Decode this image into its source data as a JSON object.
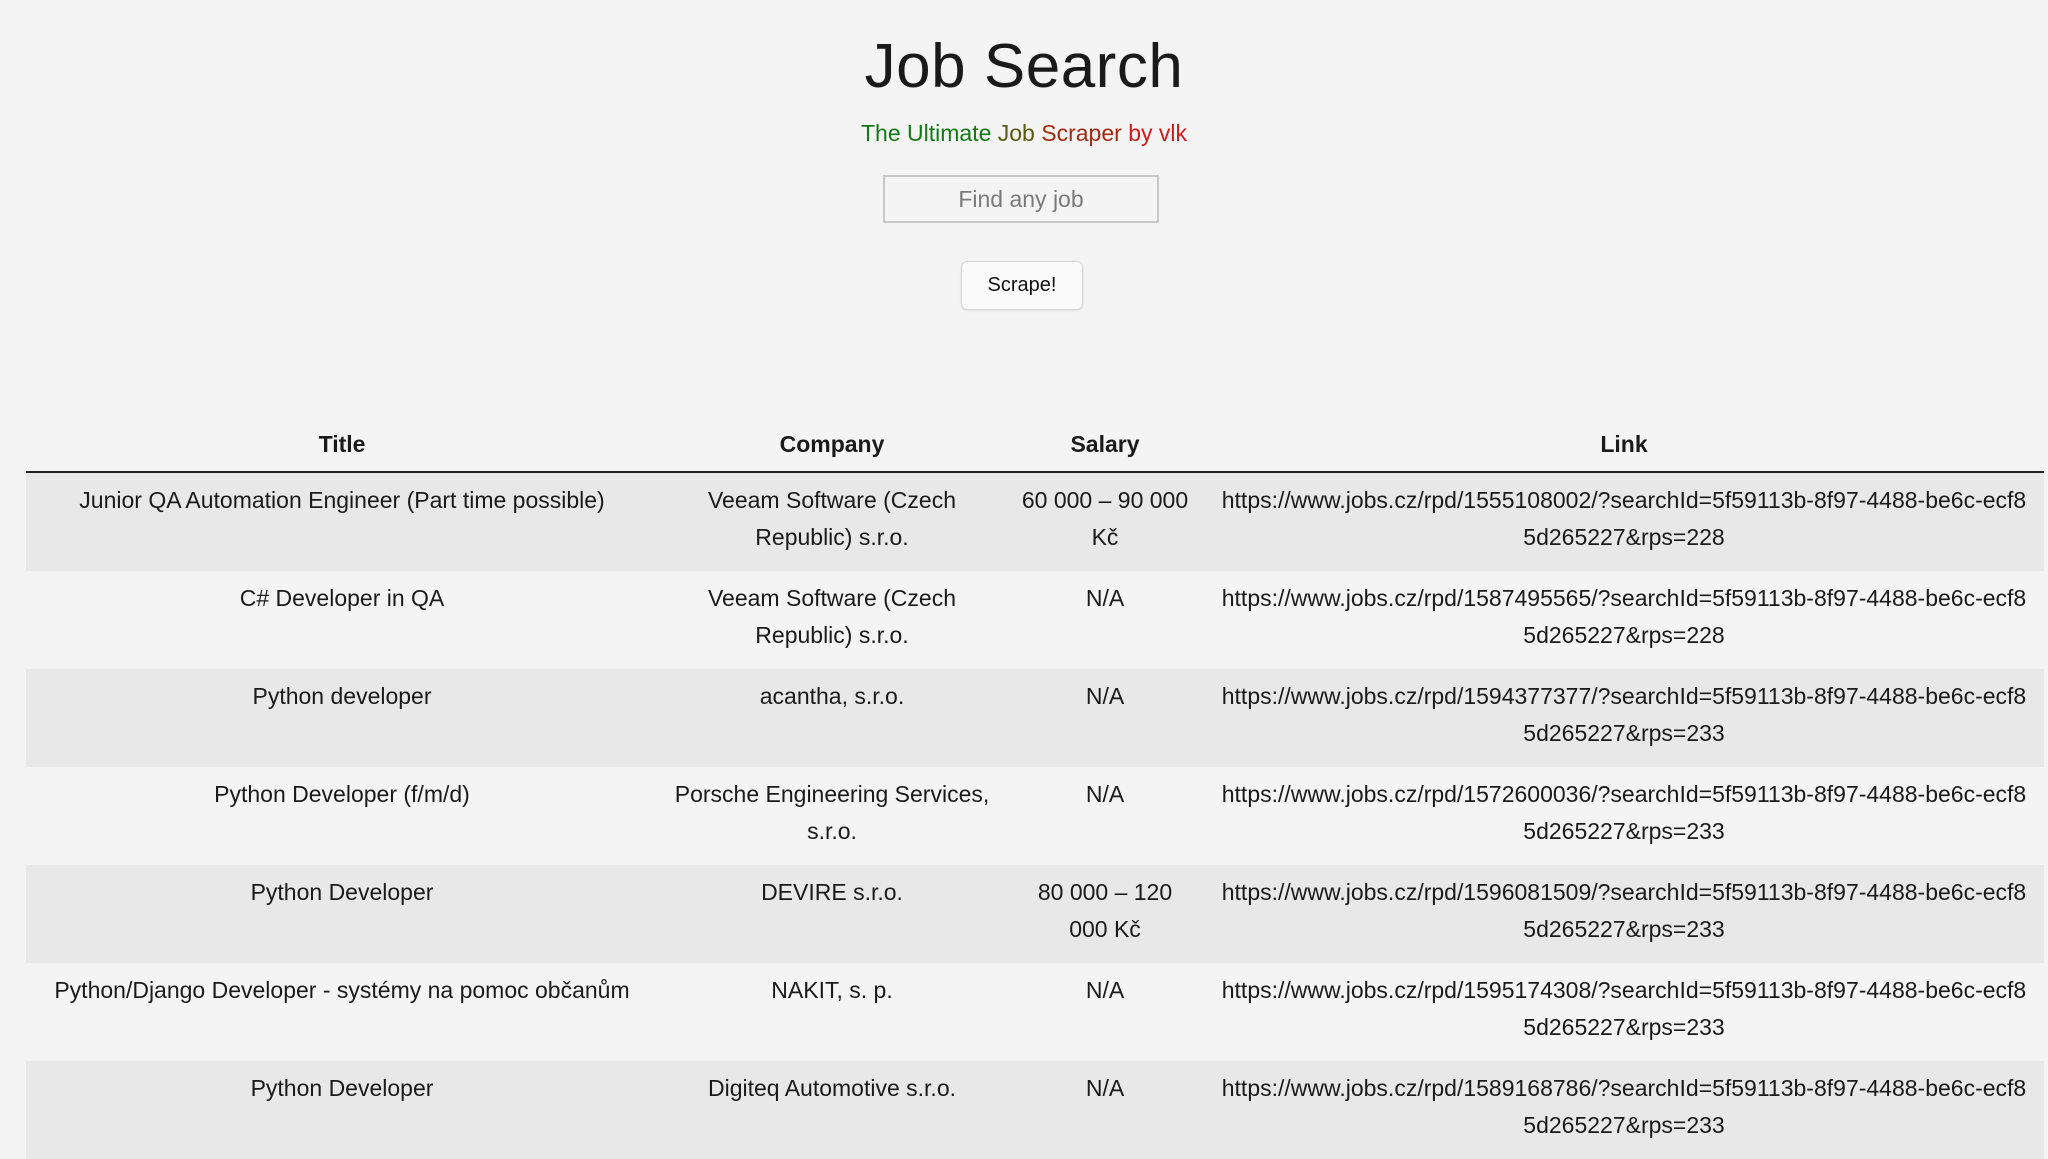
{
  "header": {
    "title": "Job Search",
    "subtitle_parts": [
      "The Ultimate ",
      "Job ",
      "Scraper ",
      "by vlk"
    ]
  },
  "search": {
    "placeholder": "Find any job",
    "value": ""
  },
  "actions": {
    "scrape_label": "Scrape!"
  },
  "colors": {
    "subtitle_1": "#137a13",
    "subtitle_2": "#5a5a12",
    "subtitle_3": "#a52a0d",
    "subtitle_4": "#d31a1a",
    "row_stripe": "#e8e8e8",
    "background": "#f4f4f4"
  },
  "table": {
    "headers": [
      "Title",
      "Company",
      "Salary",
      "Link"
    ],
    "rows": [
      {
        "title": "Junior QA Automation Engineer (Part time possible)",
        "company": "Veeam Software (Czech Republic) s.r.o.",
        "salary": "60 000 – 90 000 Kč",
        "link": "https://www.jobs.cz/rpd/1555108002/?searchId=5f59113b-8f97-4488-be6c-ecf85d265227&rps=228"
      },
      {
        "title": "C# Developer in QA",
        "company": "Veeam Software (Czech Republic) s.r.o.",
        "salary": "N/A",
        "link": "https://www.jobs.cz/rpd/1587495565/?searchId=5f59113b-8f97-4488-be6c-ecf85d265227&rps=228"
      },
      {
        "title": "Python developer",
        "company": "acantha, s.r.o.",
        "salary": "N/A",
        "link": "https://www.jobs.cz/rpd/1594377377/?searchId=5f59113b-8f97-4488-be6c-ecf85d265227&rps=233"
      },
      {
        "title": "Python Developer (f/m/d)",
        "company": "Porsche Engineering Services, s.r.o.",
        "salary": "N/A",
        "link": "https://www.jobs.cz/rpd/1572600036/?searchId=5f59113b-8f97-4488-be6c-ecf85d265227&rps=233"
      },
      {
        "title": "Python Developer",
        "company": "DEVIRE s.r.o.",
        "salary": "80 000 – 120 000 Kč",
        "link": "https://www.jobs.cz/rpd/1596081509/?searchId=5f59113b-8f97-4488-be6c-ecf85d265227&rps=233"
      },
      {
        "title": "Python/Django Developer - systémy na pomoc občanům",
        "company": "NAKIT, s. p.",
        "salary": "N/A",
        "link": "https://www.jobs.cz/rpd/1595174308/?searchId=5f59113b-8f97-4488-be6c-ecf85d265227&rps=233"
      },
      {
        "title": "Python Developer",
        "company": "Digiteq Automotive s.r.o.",
        "salary": "N/A",
        "link": "https://www.jobs.cz/rpd/1589168786/?searchId=5f59113b-8f97-4488-be6c-ecf85d265227&rps=233"
      }
    ]
  }
}
